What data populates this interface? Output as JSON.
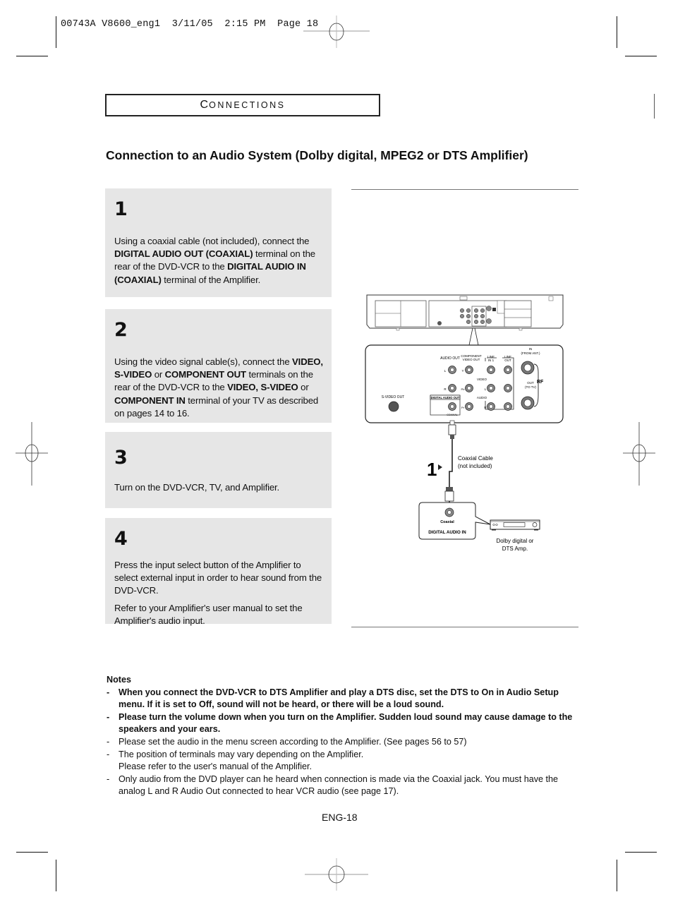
{
  "print_slug": "00743A V8600_eng1  3/11/05  2:15 PM  Page 18",
  "section": {
    "first_letter": "C",
    "rest": "ONNECTIONS",
    "full": "Connections"
  },
  "heading": "Connection to an Audio System (Dolby digital, MPEG2 or DTS Amplifier)",
  "steps": [
    {
      "number": "1",
      "paragraphs": [
        [
          {
            "text": "Using a coaxial cable (not included), connect the ",
            "bold": false
          },
          {
            "text": "DIGITAL AUDIO OUT (COAXIAL)",
            "bold": true
          },
          {
            "text": " terminal on the rear of the DVD-VCR to the ",
            "bold": false
          },
          {
            "text": "DIGITAL AUDIO IN (COAXIAL)",
            "bold": true
          },
          {
            "text": " terminal of the Amplifier.",
            "bold": false
          }
        ]
      ]
    },
    {
      "number": "2",
      "paragraphs": [
        [
          {
            "text": "Using the video signal cable(s), connect the ",
            "bold": false
          },
          {
            "text": "VIDEO, S-VIDEO",
            "bold": true
          },
          {
            "text": " or ",
            "bold": false
          },
          {
            "text": "COMPONENT OUT",
            "bold": true
          },
          {
            "text": " terminals on the rear of the DVD-VCR to the ",
            "bold": false
          },
          {
            "text": "VIDEO, S-VIDEO",
            "bold": true
          },
          {
            "text": " or ",
            "bold": false
          },
          {
            "text": "COMPONENT IN",
            "bold": true
          },
          {
            "text": " terminal of your TV as described on pages 14 to 16.",
            "bold": false
          }
        ]
      ]
    },
    {
      "number": "3",
      "paragraphs": [
        [
          {
            "text": "Turn on the DVD-VCR, TV, and Amplifier.",
            "bold": false
          }
        ]
      ]
    },
    {
      "number": "4",
      "paragraphs": [
        [
          {
            "text": "Press the input select button of the Amplifier to select external input in order to hear sound from the DVD-VCR.",
            "bold": false
          }
        ],
        [
          {
            "text": "Refer to your Amplifier's user manual to set the Amplifier's audio input.",
            "bold": false
          }
        ]
      ]
    }
  ],
  "diagram": {
    "rear_panel_labels": {
      "audio_out": "AUDIO OUT",
      "component_video_out_1": "COMPONENT",
      "component_video_out_2": "VIDEO OUT",
      "line_in": "LINE",
      "line_in_2": "IN 1",
      "line_out": "LINE",
      "line_out_2": "OUT",
      "in_from_ant_1": "IN",
      "in_from_ant_2": "(FROM ANT.)",
      "out_to_tv_1": "OUT",
      "out_to_tv_2": "(TO TV)",
      "rf": "RF",
      "video": "VIDEO",
      "audio": "AUDIO",
      "l": "L",
      "r": "R",
      "y": "Y",
      "pb": "Pb",
      "pr": "Pr",
      "s_video_out": "S-VIDEO OUT",
      "digital_audio_out": "DIGITAL AUDIO OUT",
      "coaxial_small": "COAXIAL"
    },
    "step_marker": "1",
    "cable_label_1": "Coaxial Cable",
    "cable_label_2": "(not included)",
    "amp_jack_label": "Coaxial",
    "amp_input_label": "DIGITAL AUDIO IN",
    "amp_caption_1": "Dolby digital or",
    "amp_caption_2": "DTS Amp."
  },
  "notes": {
    "title": "Notes",
    "items": [
      {
        "lines": [
          "When you connect the DVD-VCR to DTS Amplifier and play a DTS disc, set the DTS to On in Audio Setup menu. If it is set to Off, sound will not be heard, or there will be a loud sound."
        ],
        "bold": true
      },
      {
        "lines": [
          "Please turn the volume down when you turn on the Amplifier. Sudden loud sound may cause damage to the speakers and your ears."
        ],
        "bold": true
      },
      {
        "lines": [
          "Please set the audio in the menu screen according to the Amplifier. (See pages 56 to 57)"
        ],
        "bold": false
      },
      {
        "lines": [
          "The position of terminals may vary depending on the Amplifier.",
          "Please refer to the user's manual of the Amplifier."
        ],
        "bold": false
      },
      {
        "lines": [
          "Only audio from the DVD player can he heard when connection is made via the Coaxial jack. You must have the analog L and R Audio Out connected to hear VCR audio (see page 17)."
        ],
        "bold": false
      }
    ]
  },
  "page_number": "ENG-18"
}
